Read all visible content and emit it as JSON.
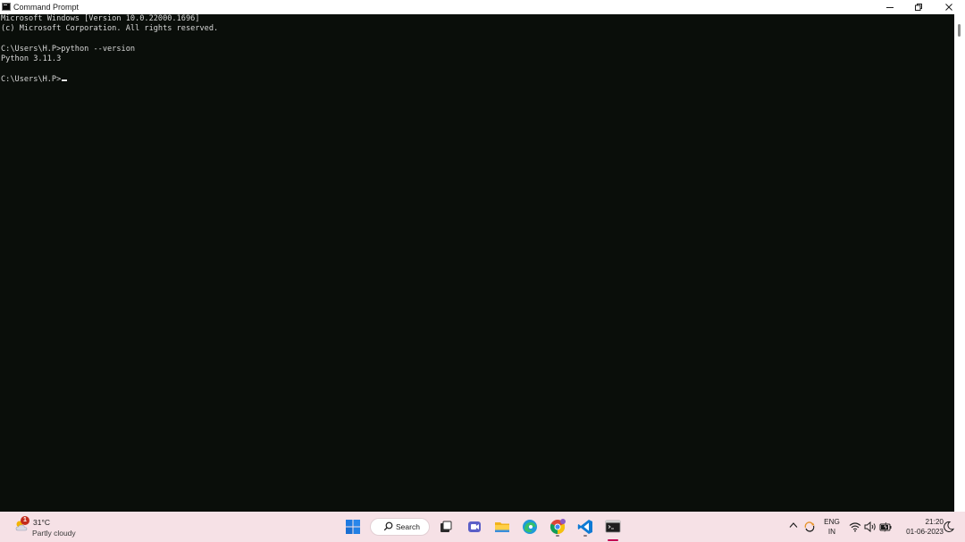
{
  "window": {
    "title": "Command Prompt",
    "icon": "cmd-icon",
    "controls": {
      "minimize": "–",
      "maximize": "❐",
      "close": "✕"
    }
  },
  "console": {
    "lines": [
      "Microsoft Windows [Version 10.0.22000.1696]",
      "(c) Microsoft Corporation. All rights reserved.",
      "",
      "C:\\Users\\H.P>python --version",
      "Python 3.11.3",
      "",
      "C:\\Users\\H.P>"
    ]
  },
  "taskbar": {
    "weather": {
      "badge": "1",
      "temperature": "31°C",
      "condition": "Partly cloudy"
    },
    "search_label": "Search",
    "apps": [
      "start-icon",
      "task-view-icon",
      "teams-icon",
      "file-explorer-icon",
      "edge-icon",
      "chrome-icon",
      "vscode-icon",
      "terminal-icon"
    ],
    "tray": {
      "language_line1": "ENG",
      "language_line2": "IN",
      "time": "21:20",
      "date": "01-06-2023"
    }
  },
  "colors": {
    "console_bg": "#0a0e0a",
    "console_text": "#d8d8d8",
    "taskbar_bg": "#f6e1e6",
    "accent": "#c30052"
  }
}
